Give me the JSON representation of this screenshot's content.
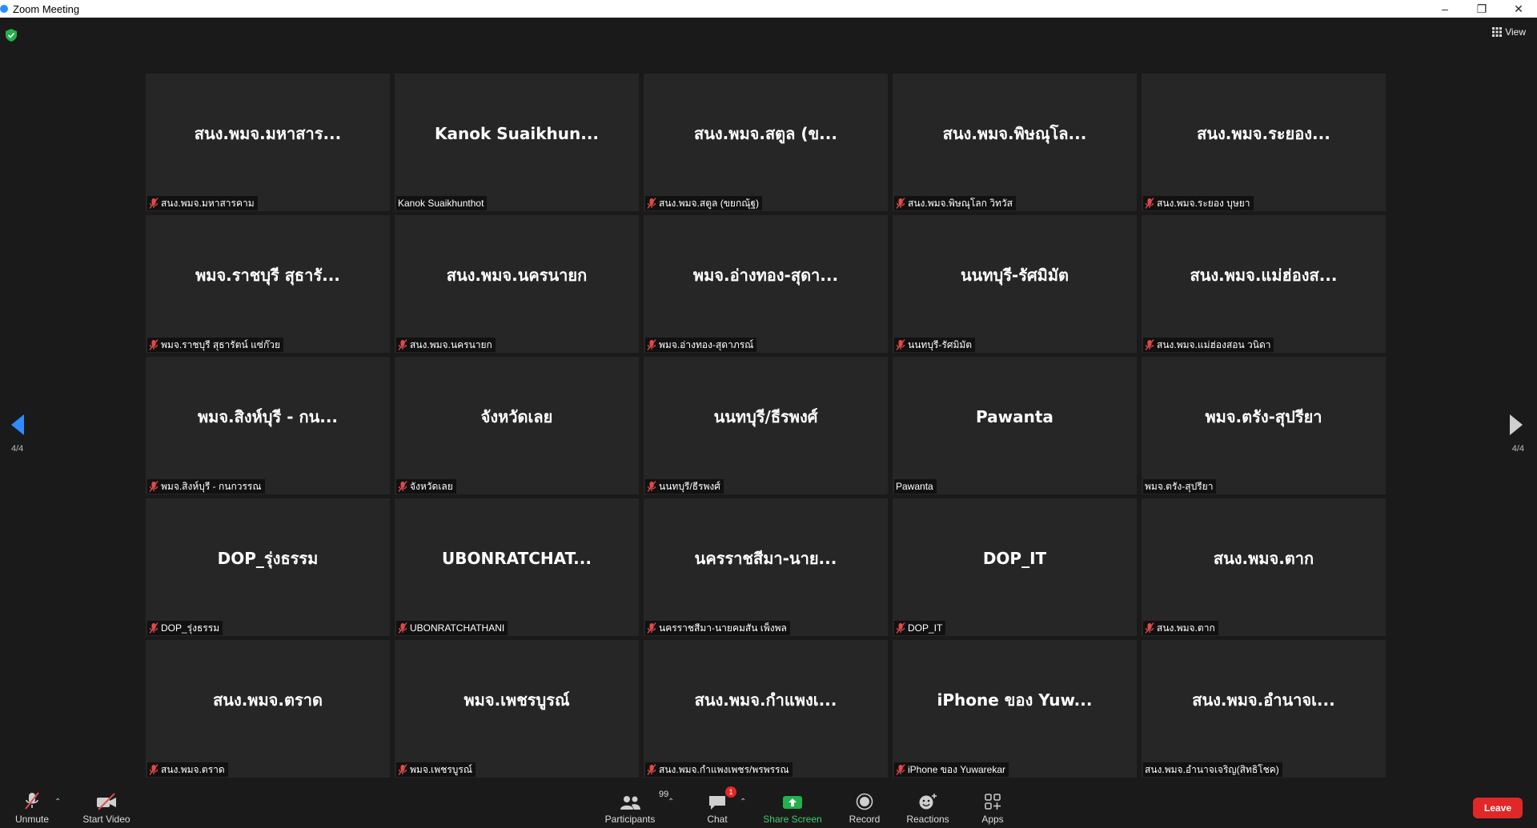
{
  "window": {
    "title": "Zoom Meeting"
  },
  "top": {
    "view_label": "View"
  },
  "pagination": {
    "indicator": "4/4"
  },
  "tiles": [
    {
      "center": "สนง.พมจ.มหาสาร...",
      "label": "สนง.พมจ.มหาสารคาม",
      "muted": true
    },
    {
      "center": "Kanok  Suaikhun...",
      "label": "Kanok Suaikhunthot",
      "muted": false
    },
    {
      "center": "สนง.พมจ.สตูล (ข...",
      "label": "สนง.พมจ.สตูล (ขยกณุ้ฐ)",
      "muted": true
    },
    {
      "center": "สนง.พมจ.พิษณุโล...",
      "label": "สนง.พมจ.พิษณุโลก วิทวัส",
      "muted": true
    },
    {
      "center": "สนง.พมจ.ระยอง...",
      "label": "สนง.พมจ.ระยอง บุษยา",
      "muted": true
    },
    {
      "center": "พมจ.ราชบุรี  สุธารั...",
      "label": "พมจ.ราชบุรี  สุธารัตน์  แซ่ก๊วย",
      "muted": true
    },
    {
      "center": "สนง.พมจ.นครนายก",
      "label": "สนง.พมจ.นครนายก",
      "muted": true
    },
    {
      "center": "พมจ.อ่างทอง-สุดา...",
      "label": "พมจ.อ่างทอง-สุดาภรณ์",
      "muted": true
    },
    {
      "center": "นนทบุรี-รัศมิมัต",
      "label": "นนทบุรี-รัศมิมัต",
      "muted": true
    },
    {
      "center": "สนง.พมจ.แม่ฮ่องส...",
      "label": "สนง.พมจ.แม่ฮ่องสอน วนิดา",
      "muted": true
    },
    {
      "center": "พมจ.สิงห์บุรี  - กน...",
      "label": "พมจ.สิงห์บุรี  - กนกวรรณ",
      "muted": true
    },
    {
      "center": "จังหวัดเลย",
      "label": "จังหวัดเลย",
      "muted": true
    },
    {
      "center": "นนทบุรี/ธีรพงศ์",
      "label": "นนทบุรี/ธีรพงศ์",
      "muted": true
    },
    {
      "center": "Pawanta",
      "label": "Pawanta",
      "muted": false
    },
    {
      "center": "พมจ.ตรัง-สุปรียา",
      "label": "พมจ.ตรัง-สุปรียา",
      "muted": false
    },
    {
      "center": "DOP_รุ่งธรรม",
      "label": "DOP_รุ่งธรรม",
      "muted": true
    },
    {
      "center": "UBONRATCHAT...",
      "label": "UBONRATCHATHANI",
      "muted": true
    },
    {
      "center": "นครราชสีมา-นาย...",
      "label": "นครราชสีมา-นายคมสัน เพ็งพล",
      "muted": true
    },
    {
      "center": "DOP_IT",
      "label": "DOP_IT",
      "muted": true
    },
    {
      "center": "สนง.พมจ.ตาก",
      "label": "สนง.พมจ.ตาก",
      "muted": true
    },
    {
      "center": "สนง.พมจ.ตราด",
      "label": "สนง.พมจ.ตราด",
      "muted": true
    },
    {
      "center": "พมจ.เพชรบูรณ์",
      "label": "พมจ.เพชรบูรณ์",
      "muted": true
    },
    {
      "center": "สนง.พมจ.กำแพงเ...",
      "label": "สนง.พมจ.กำแพงเพชร/พรพรรณ",
      "muted": true
    },
    {
      "center": "iPhone ของ Yuw...",
      "label": "iPhone ของ Yuwarekar",
      "muted": true
    },
    {
      "center": "สนง.พมจ.อำนาจเ...",
      "label": "สนง.พมจ.อำนาจเจริญ(สิทธิโชค)",
      "muted": false
    }
  ],
  "toolbar": {
    "unmute": "Unmute",
    "start_video": "Start Video",
    "participants": "Participants",
    "participants_count": "99",
    "chat": "Chat",
    "chat_badge": "1",
    "share_screen": "Share Screen",
    "record": "Record",
    "reactions": "Reactions",
    "apps": "Apps",
    "leave": "Leave"
  },
  "colors": {
    "background": "#1a1a1a",
    "tile": "#262626",
    "accent_blue": "#2d8cff",
    "share_green": "#22b14c",
    "leave_red": "#e02828",
    "muted_red": "#e04a4a"
  }
}
